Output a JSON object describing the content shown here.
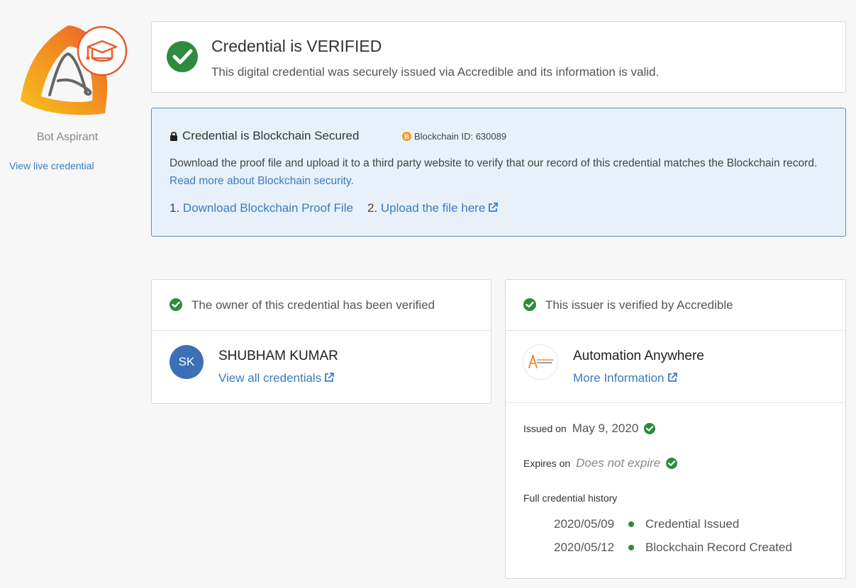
{
  "colors": {
    "accent": "#3a7bbf",
    "success": "#2e8b3e",
    "brand_orange": "#f07a1c",
    "avatar_bg": "#3b6fb6"
  },
  "sidebar": {
    "badge_icon": "bot-aspirant-badge",
    "badge_name": "Bot Aspirant",
    "view_live": "View live credential"
  },
  "verified": {
    "icon": "check-circle-icon",
    "title": "Credential is VERIFIED",
    "description": "This digital credential was securely issued via Accredible and its information is valid."
  },
  "blockchain": {
    "icon": "lock-icon",
    "title": "Credential is Blockchain Secured",
    "id_badge": "B",
    "id_label": "Blockchain ID: 630089",
    "description": "Download the proof file and upload it to a third party website to verify that our record of this credential matches the Blockchain record.",
    "read_more": "Read more about Blockchain security.",
    "step1_prefix": "1.",
    "step1_link": "Download Blockchain Proof File",
    "step2_prefix": "2.",
    "step2_link": "Upload the file here"
  },
  "owner": {
    "header": "The owner of this credential has been verified",
    "initials": "SK",
    "name": "SHUBHAM KUMAR",
    "link": "View all credentials"
  },
  "issuer": {
    "header": "This issuer is verified by Accredible",
    "logo_text": "AUTOMATION ANYWHERE",
    "name": "Automation Anywhere",
    "link": "More Information",
    "issued_label": "Issued on",
    "issued_value": "May 9, 2020",
    "expires_label": "Expires on",
    "expires_value": "Does not expire",
    "history_title": "Full credential history",
    "history": [
      {
        "date": "2020/05/09",
        "event": "Credential Issued"
      },
      {
        "date": "2020/05/12",
        "event": "Blockchain Record Created"
      }
    ]
  }
}
